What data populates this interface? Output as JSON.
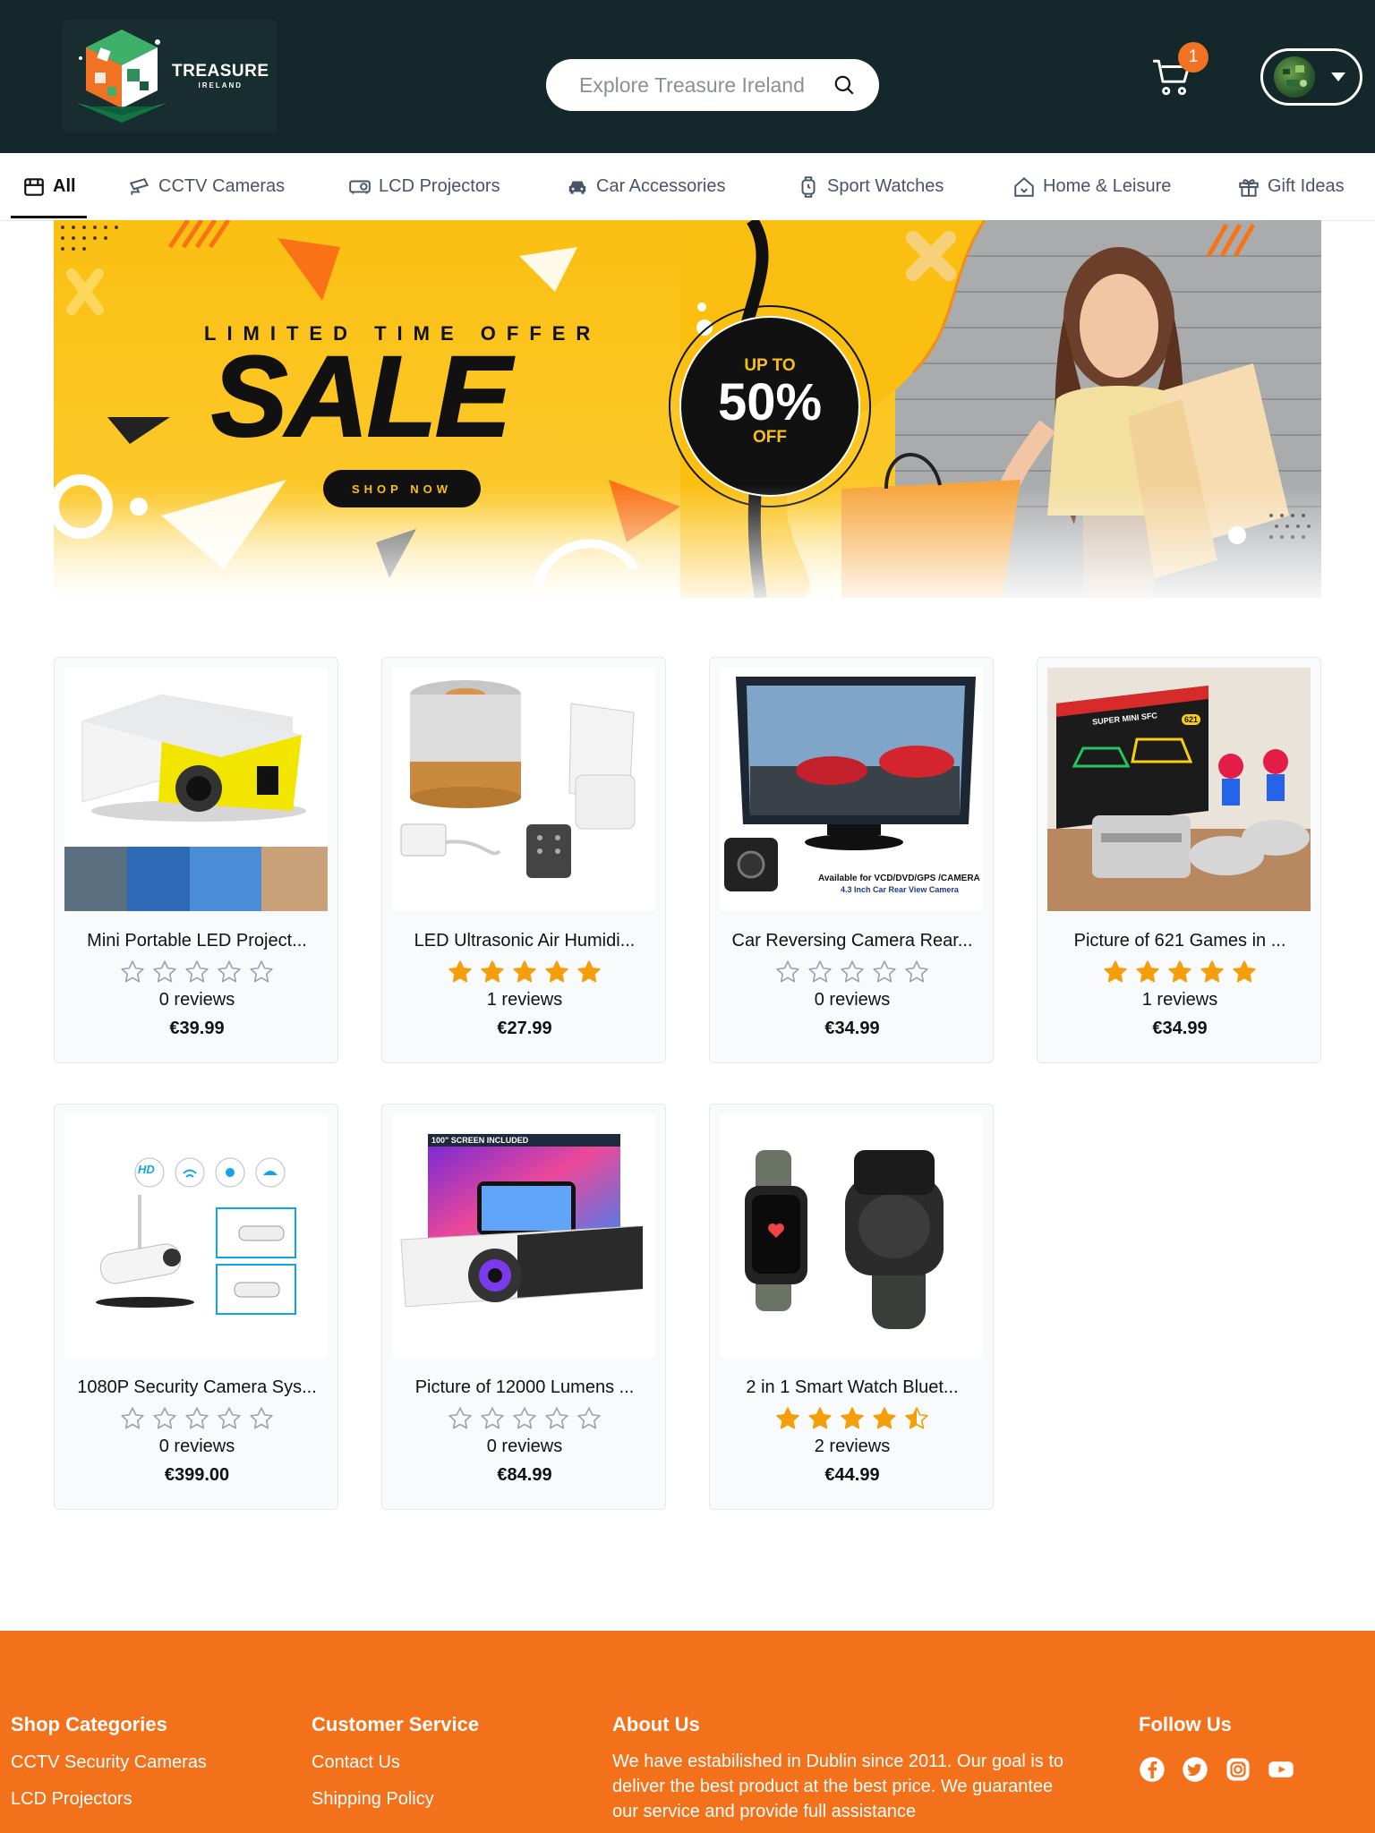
{
  "brand": {
    "name": "TREASURE",
    "sub": "IRELAND"
  },
  "search": {
    "placeholder": "Explore Treasure Ireland"
  },
  "cart": {
    "count": "1"
  },
  "categories": [
    {
      "label": "All",
      "icon": "store-icon"
    },
    {
      "label": "CCTV Cameras",
      "icon": "cctv-icon"
    },
    {
      "label": "LCD Projectors",
      "icon": "projector-icon"
    },
    {
      "label": "Car Accessories",
      "icon": "car-icon"
    },
    {
      "label": "Sport Watches",
      "icon": "watch-icon"
    },
    {
      "label": "Home & Leisure",
      "icon": "home-icon"
    },
    {
      "label": "Gift Ideas",
      "icon": "gift-icon"
    }
  ],
  "banner": {
    "line1": "LIMITED TIME OFFER",
    "headline": "SALE",
    "cta": "SHOP NOW",
    "badge_top": "UP TO",
    "badge_value": "50%",
    "badge_bottom": "OFF"
  },
  "products": [
    {
      "title": "Mini Portable LED Project...",
      "rating": 0,
      "reviews": "0 reviews",
      "price": "€39.99"
    },
    {
      "title": "LED Ultrasonic Air Humidi...",
      "rating": 5,
      "reviews": "1 reviews",
      "price": "€27.99"
    },
    {
      "title": "Car Reversing Camera Rear...",
      "rating": 0,
      "reviews": "0 reviews",
      "price": "€34.99",
      "img_caption": "Available for VCD/DVD/GPS /CAMERA",
      "img_caption2": "4.3 Inch Car Rear View Camera"
    },
    {
      "title": "Picture of 621 Games in ...",
      "rating": 5,
      "reviews": "1 reviews",
      "price": "€34.99",
      "img_caption": "SUPER MINI SFC",
      "img_badge": "621"
    },
    {
      "title": "1080P Security Camera Sys...",
      "rating": 0,
      "reviews": "0 reviews",
      "price": "€399.00",
      "img_caption": "HD"
    },
    {
      "title": "Picture of 12000 Lumens ...",
      "rating": 0,
      "reviews": "0 reviews",
      "price": "€84.99",
      "img_caption": "100\" SCREEN INCLUDED"
    },
    {
      "title": "2 in 1 Smart Watch Bluet...",
      "rating": 4.5,
      "reviews": "2 reviews",
      "price": "€44.99"
    }
  ],
  "footer": {
    "shop": {
      "heading": "Shop Categories",
      "links": [
        "CCTV Security Cameras",
        "LCD Projectors"
      ]
    },
    "service": {
      "heading": "Customer Service",
      "links": [
        "Contact Us",
        "Shipping Policy"
      ]
    },
    "about": {
      "heading": "About Us",
      "text": "We have estabilished in Dublin since 2011. Our goal is to deliver the best product at the best price. We guarantee our service and provide full assistance"
    },
    "follow": {
      "heading": "Follow Us",
      "networks": [
        "facebook-icon",
        "twitter-icon",
        "instagram-icon",
        "youtube-icon"
      ]
    }
  },
  "colors": {
    "header_bg": "#14272a",
    "accent": "#f4711c",
    "star": "#f59e0b",
    "star_empty": "#9ca3af"
  }
}
